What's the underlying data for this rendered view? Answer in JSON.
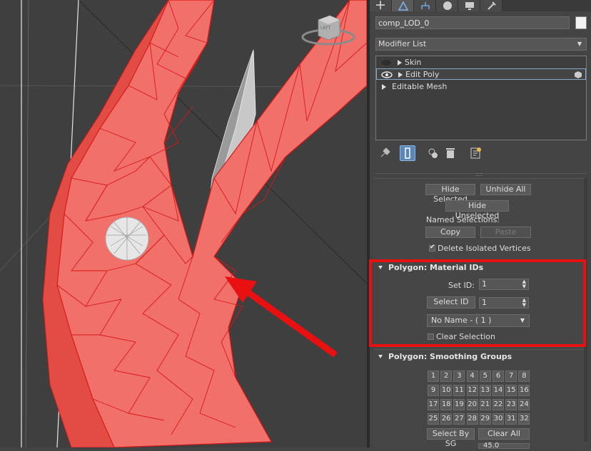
{
  "viewport": {
    "viewcube_label": "LEFT"
  },
  "tabs": [
    {
      "name": "create-tab-icon"
    },
    {
      "name": "modify-tab-icon",
      "active": true
    },
    {
      "name": "hierarchy-tab-icon"
    },
    {
      "name": "motion-tab-icon"
    },
    {
      "name": "display-tab-icon"
    },
    {
      "name": "utilities-tab-icon"
    }
  ],
  "object_name": "comp_LOD_0",
  "object_color": "#f2f2f2",
  "modifier_list_label": "Modifier List",
  "stack": {
    "items": [
      {
        "label": "Skin",
        "eye": "hidden"
      },
      {
        "label": "Edit Poly",
        "eye": "visible",
        "selected": true
      },
      {
        "label": "Editable Mesh",
        "eye": "none"
      }
    ]
  },
  "selection_rollout": {
    "hide_selected": "Hide Selected",
    "unhide_all": "Unhide All",
    "hide_unselected": "Hide Unselected",
    "named_selections": "Named Selections:",
    "copy": "Copy",
    "paste": "Paste",
    "delete_isolated": "Delete Isolated Vertices",
    "delete_isolated_checked": true
  },
  "material_ids": {
    "title": "Polygon: Material IDs",
    "set_id_label": "Set ID:",
    "set_id_value": "1",
    "select_id_button": "Select ID",
    "select_id_value": "1",
    "name_dropdown": "No Name - ( 1 )",
    "clear_selection": "Clear Selection"
  },
  "smoothing_groups": {
    "title": "Polygon: Smoothing Groups",
    "groups": [
      "1",
      "2",
      "3",
      "4",
      "5",
      "6",
      "7",
      "8",
      "9",
      "10",
      "11",
      "12",
      "13",
      "14",
      "15",
      "16",
      "17",
      "18",
      "19",
      "20",
      "21",
      "22",
      "23",
      "24",
      "25",
      "26",
      "27",
      "28",
      "29",
      "30",
      "31",
      "32"
    ],
    "select_by_sg": "Select By SG",
    "clear_all": "Clear All",
    "auto_smooth_value": "45.0"
  },
  "colors": {
    "highlight": "#e81010",
    "mesh_fill": "#f2706a",
    "mesh_edge": "#d81818",
    "selection_accent": "#5b86b8"
  }
}
